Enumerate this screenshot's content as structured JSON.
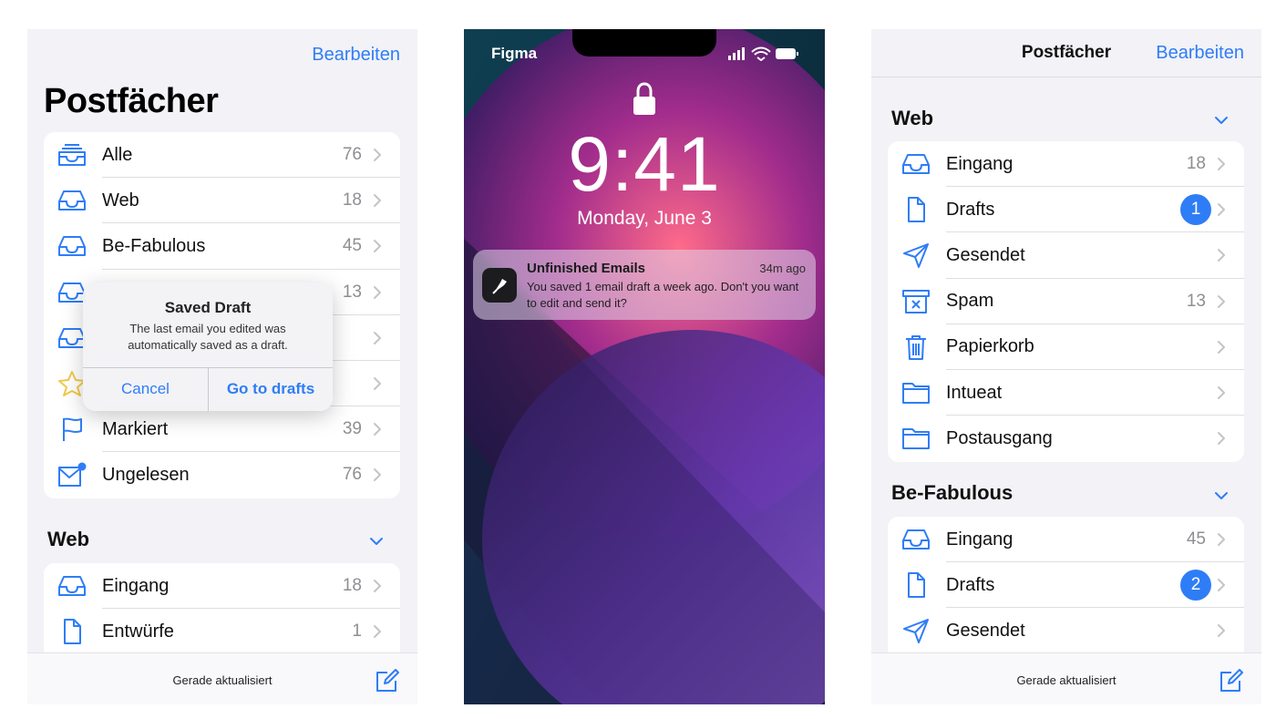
{
  "screen1": {
    "edit_label": "Bearbeiten",
    "title": "Postfächer",
    "mailboxes": [
      {
        "label": "Alle",
        "count": "76"
      },
      {
        "label": "Web",
        "count": "18"
      },
      {
        "label": "Be-Fabulous",
        "count": "45"
      },
      {
        "label": "",
        "count": "13"
      },
      {
        "label": "",
        "count": ""
      },
      {
        "label": "",
        "count": ""
      },
      {
        "label": "Markiert",
        "count": "39"
      },
      {
        "label": "Ungelesen",
        "count": "76"
      }
    ],
    "web_section": {
      "title": "Web",
      "items": [
        {
          "label": "Eingang",
          "count": "18"
        },
        {
          "label": "Entwürfe",
          "count": "1"
        }
      ]
    },
    "alert": {
      "title": "Saved Draft",
      "message": "The last email you edited was automatically saved as a draft.",
      "cancel_label": "Cancel",
      "go_label": "Go to drafts"
    },
    "toolbar_status": "Gerade aktualisiert"
  },
  "screen2": {
    "carrier": "Figma",
    "time": "9:41",
    "date": "Monday, June 3",
    "notification": {
      "title": "Unfinished Emails",
      "time": "34m ago",
      "body": "You saved 1 email draft a week ago. Don't you want to edit and send it?"
    }
  },
  "screen3": {
    "title": "Postfächer",
    "edit_label": "Bearbeiten",
    "web_section": {
      "title": "Web",
      "items": [
        {
          "label": "Eingang",
          "count": "18",
          "badge": ""
        },
        {
          "label": "Drafts",
          "count": "",
          "badge": "1"
        },
        {
          "label": "Gesendet",
          "count": "",
          "badge": ""
        },
        {
          "label": "Spam",
          "count": "13",
          "badge": ""
        },
        {
          "label": "Papierkorb",
          "count": "",
          "badge": ""
        },
        {
          "label": "Intueat",
          "count": "",
          "badge": ""
        },
        {
          "label": "Postausgang",
          "count": "",
          "badge": ""
        }
      ]
    },
    "fabulous_section": {
      "title": "Be-Fabulous",
      "items": [
        {
          "label": "Eingang",
          "count": "45",
          "badge": ""
        },
        {
          "label": "Drafts",
          "count": "",
          "badge": "2"
        },
        {
          "label": "Gesendet",
          "count": "",
          "badge": ""
        }
      ]
    },
    "toolbar_status": "Gerade aktualisiert"
  },
  "colors": {
    "accent": "#2f7df6",
    "background": "#f2f2f7",
    "badge": "#2f7df6",
    "flag_star": "#f2c94c"
  },
  "icons": {
    "inbox": "tray-icon",
    "all": "tray-stack-icon",
    "draft": "document-icon",
    "sent": "paperplane-icon",
    "spam": "xmark-bin-icon",
    "trash": "trash-icon",
    "folder": "folder-icon",
    "flag": "flag-icon",
    "star": "star-icon",
    "unread": "envelope-badge-icon",
    "compose": "square-pencil-icon"
  }
}
